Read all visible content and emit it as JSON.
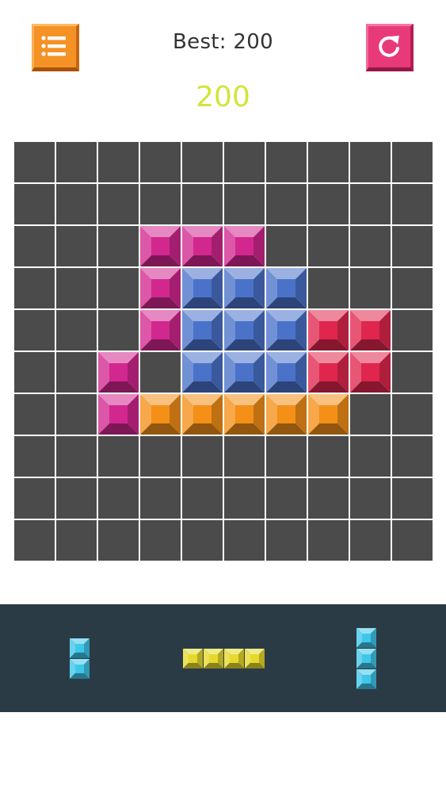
{
  "header": {
    "best_label": "Best: 200",
    "score": "200",
    "menu_icon": "list-icon",
    "restart_icon": "restart-icon"
  },
  "colors": {
    "empty": "#4b4b4b",
    "pink": "#d2278f",
    "blue": "#4a72c9",
    "red": "#e0264d",
    "orange": "#f48f17",
    "cyan": "#3fc7ea",
    "yellow": "#e6d92b",
    "score": "#d3e33a",
    "tray": "#2b3b45"
  },
  "board": {
    "rows": 10,
    "cols": 10,
    "cells": [
      [
        "",
        "",
        "",
        "",
        "",
        "",
        "",
        "",
        "",
        ""
      ],
      [
        "",
        "",
        "",
        "",
        "",
        "",
        "",
        "",
        "",
        ""
      ],
      [
        "",
        "",
        "",
        "pink",
        "pink",
        "pink",
        "",
        "",
        "",
        ""
      ],
      [
        "",
        "",
        "",
        "pink",
        "blue",
        "blue",
        "blue",
        "",
        "",
        ""
      ],
      [
        "",
        "",
        "",
        "pink",
        "blue",
        "blue",
        "blue",
        "red",
        "red",
        ""
      ],
      [
        "",
        "",
        "pink",
        "",
        "blue",
        "blue",
        "blue",
        "red",
        "red",
        ""
      ],
      [
        "",
        "",
        "pink",
        "orange",
        "orange",
        "orange",
        "orange",
        "orange",
        "",
        ""
      ],
      [
        "",
        "",
        "",
        "",
        "",
        "",
        "",
        "",
        "",
        ""
      ],
      [
        "",
        "",
        "",
        "",
        "",
        "",
        "",
        "",
        "",
        ""
      ],
      [
        "",
        "",
        "",
        "",
        "",
        "",
        "",
        "",
        "",
        ""
      ]
    ]
  },
  "tray": {
    "pieces": [
      {
        "name": "piece-vertical-2",
        "color": "cyan",
        "orientation": "vertical",
        "length": 2
      },
      {
        "name": "piece-horizontal-4",
        "color": "yellow",
        "orientation": "horizontal",
        "length": 4
      },
      {
        "name": "piece-vertical-3",
        "color": "cyan",
        "orientation": "vertical",
        "length": 3
      }
    ]
  }
}
